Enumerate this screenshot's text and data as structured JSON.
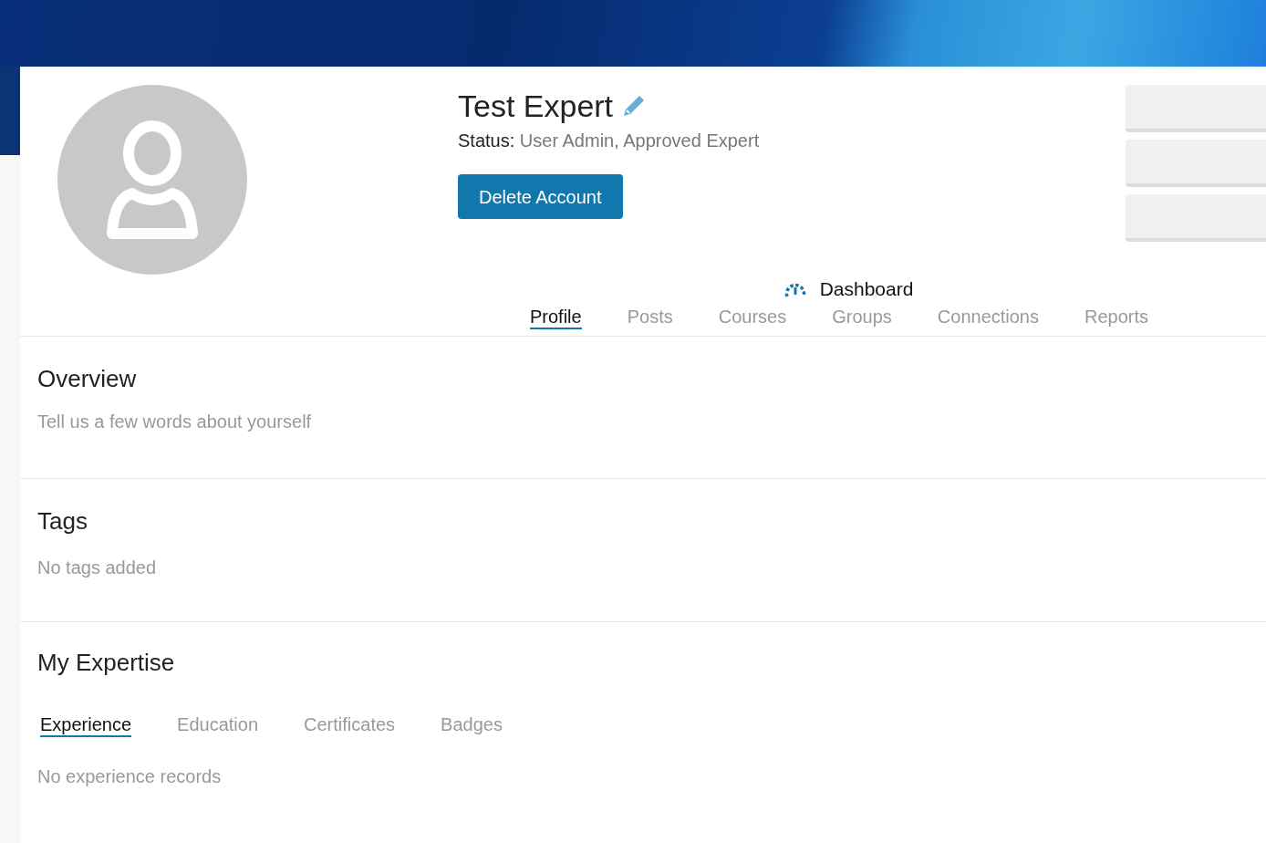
{
  "profile": {
    "name": "Test Expert",
    "status_label": "Status:",
    "status_value": "User Admin, Approved Expert",
    "delete_button": "Delete Account"
  },
  "dashboard_link": "Dashboard",
  "tabs": [
    {
      "label": "Profile",
      "selected": true
    },
    {
      "label": "Posts",
      "selected": false
    },
    {
      "label": "Courses",
      "selected": false
    },
    {
      "label": "Groups",
      "selected": false
    },
    {
      "label": "Connections",
      "selected": false
    },
    {
      "label": "Reports",
      "selected": false
    }
  ],
  "overview": {
    "title": "Overview",
    "placeholder": "Tell us a few words about yourself"
  },
  "tags": {
    "title": "Tags",
    "text": "No tags added"
  },
  "expertise": {
    "title": "My Expertise",
    "tabs": [
      {
        "label": "Experience",
        "selected": true
      },
      {
        "label": "Education",
        "selected": false
      },
      {
        "label": "Certificates",
        "selected": false
      },
      {
        "label": "Badges",
        "selected": false
      }
    ],
    "empty_text": "No experience records"
  }
}
